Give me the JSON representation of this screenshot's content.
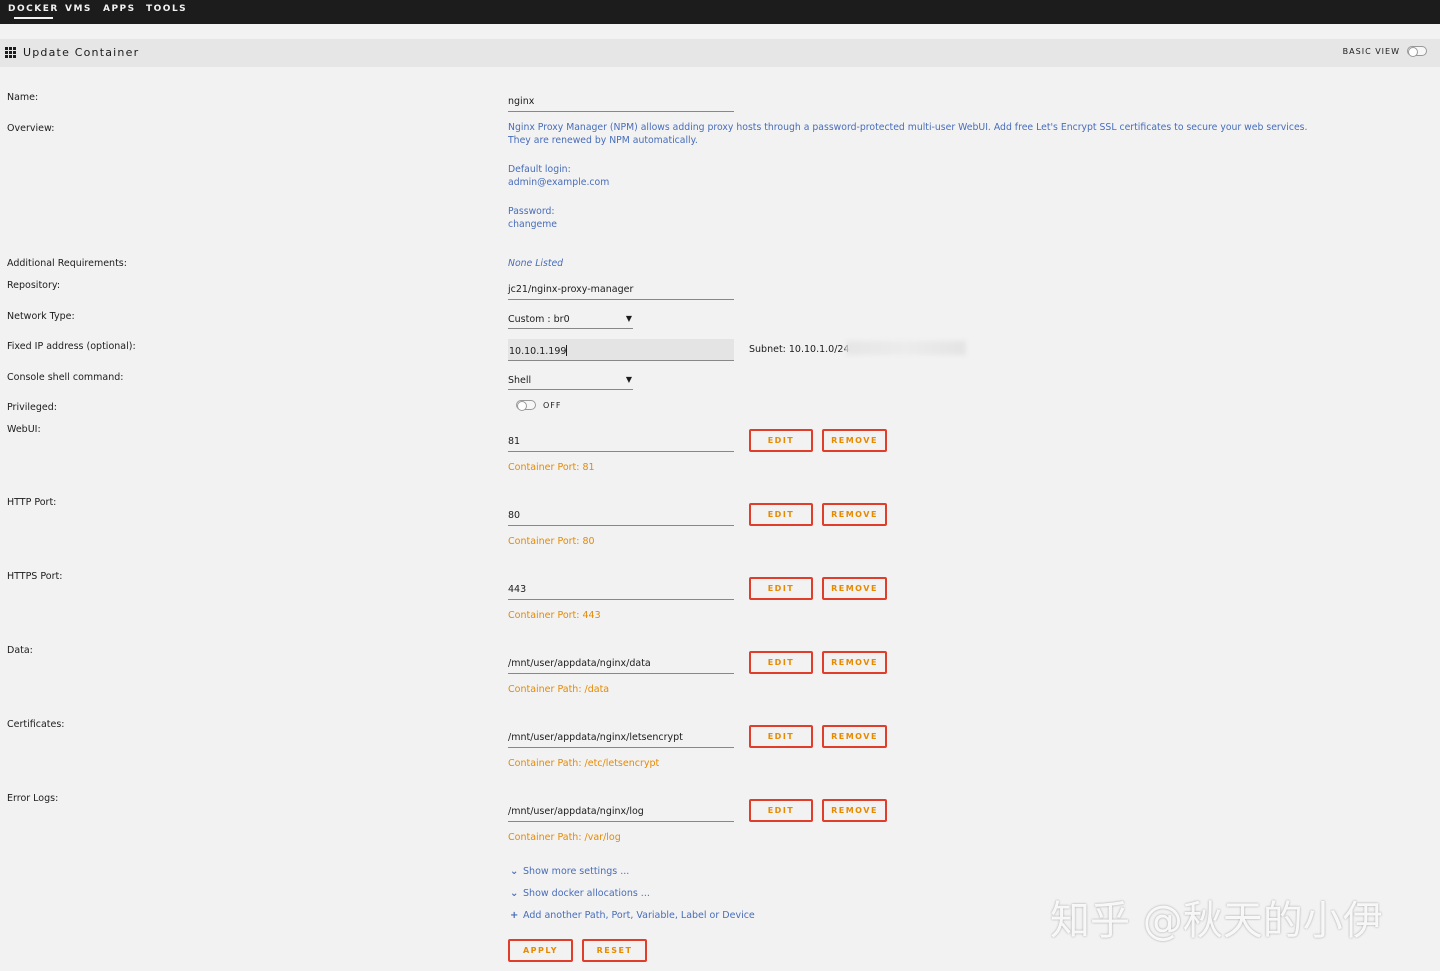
{
  "nav": {
    "docker": "DOCKER",
    "vms": "VMS",
    "apps": "APPS",
    "tools": "TOOLS"
  },
  "header": {
    "title": "Update Container",
    "basic_view": "BASIC VIEW"
  },
  "form": {
    "name": {
      "label": "Name:",
      "value": "nginx"
    },
    "overview": {
      "label": "Overview:",
      "text": "Nginx Proxy Manager (NPM) allows adding proxy hosts through a password-protected multi-user WebUI. Add free Let's Encrypt SSL certificates to secure your web services. They are renewed by NPM automatically.",
      "login_label": "Default login:",
      "login_value": "admin@example.com",
      "password_label": "Password:",
      "password_value": "changeme"
    },
    "additional": {
      "label": "Additional Requirements:",
      "value": "None Listed"
    },
    "repository": {
      "label": "Repository:",
      "value": "jc21/nginx-proxy-manager"
    },
    "network": {
      "label": "Network Type:",
      "value": "Custom : br0"
    },
    "fixed_ip": {
      "label": "Fixed IP address (optional):",
      "value": "10.10.1.199",
      "subnet": "Subnet: 10.10.1.0/24"
    },
    "console": {
      "label": "Console shell command:",
      "value": "Shell"
    },
    "privileged": {
      "label": "Privileged:",
      "state": "OFF"
    },
    "configs": [
      {
        "label": "WebUI:",
        "value": "81",
        "hint": "Container Port: 81"
      },
      {
        "label": "HTTP Port:",
        "value": "80",
        "hint": "Container Port: 80"
      },
      {
        "label": "HTTPS Port:",
        "value": "443",
        "hint": "Container Port: 443"
      },
      {
        "label": "Data:",
        "value": "/mnt/user/appdata/nginx/data",
        "hint": "Container Path: /data"
      },
      {
        "label": "Certificates:",
        "value": "/mnt/user/appdata/nginx/letsencrypt",
        "hint": "Container Path: /etc/letsencrypt"
      },
      {
        "label": "Error Logs:",
        "value": "/mnt/user/appdata/nginx/log",
        "hint": "Container Path: /var/log"
      }
    ],
    "edit_label": "EDIT",
    "remove_label": "REMOVE"
  },
  "links": {
    "more_settings": "Show more settings ...",
    "docker_alloc": "Show docker allocations ...",
    "add_another": "Add another Path, Port, Variable, Label or Device"
  },
  "actions": {
    "apply": "APPLY",
    "reset": "RESET"
  },
  "watermark": "知乎 @秋天的小伊",
  "icons": {
    "grid": "grid-icon",
    "chevron": "chevron-down-icon",
    "plus": "plus-icon"
  }
}
